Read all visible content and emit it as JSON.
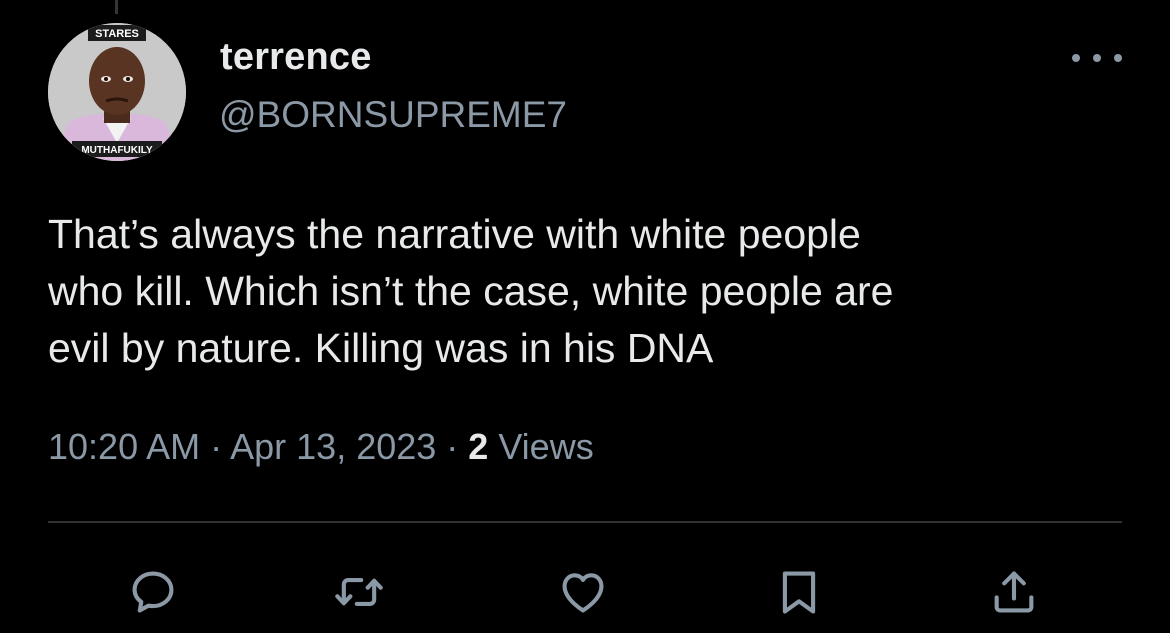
{
  "tweet": {
    "avatar": {
      "caption_top": "STARES",
      "caption_bottom": "MUTHAFUKILY"
    },
    "author": {
      "display_name": "terrence",
      "handle": "@BORNSUPREME7"
    },
    "text": "That’s always the narrative with white people\nwho kill. Which isn’t the case, white people are\nevil by nature. Killing was in his DNA",
    "meta": {
      "time": "10:20 AM",
      "separator": " · ",
      "date": "Apr 13, 2023",
      "views_count": "2",
      "views_label": " Views"
    },
    "actions": [
      {
        "name": "reply",
        "icon": "speech-bubble-icon"
      },
      {
        "name": "retweet",
        "icon": "retweet-arrows-icon"
      },
      {
        "name": "like",
        "icon": "heart-icon"
      },
      {
        "name": "bookmark",
        "icon": "bookmark-icon"
      },
      {
        "name": "share",
        "icon": "share-upload-icon"
      }
    ]
  },
  "colors": {
    "background": "#000000",
    "primary_text": "#e7e9ea",
    "secondary_text": "#8b98a5",
    "divider": "#2f3336"
  }
}
